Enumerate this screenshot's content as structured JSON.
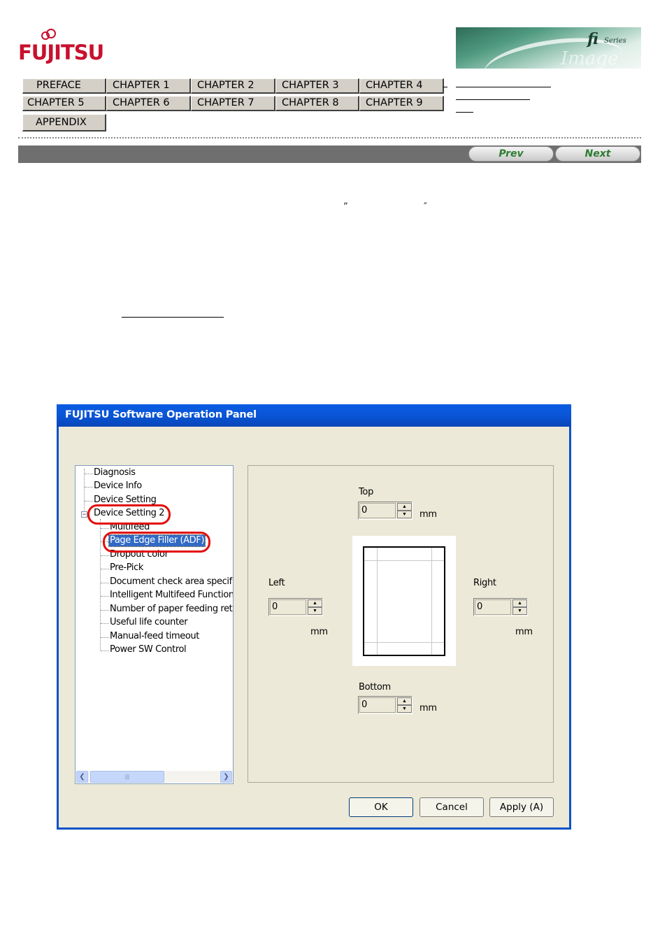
{
  "header": {
    "logo_text": "FUJITSU",
    "banner": {
      "fi": "fi",
      "series": "Series",
      "scanner": "Image Scanner"
    }
  },
  "nav": {
    "buttons": [
      "PREFACE",
      "CHAPTER 1",
      "CHAPTER 2",
      "CHAPTER 3",
      "CHAPTER 4",
      "CHAPTER 5",
      "CHAPTER 6",
      "CHAPTER 7",
      "CHAPTER 8",
      "CHAPTER 9",
      "APPENDIX"
    ],
    "prev_label": "Prev",
    "next_label": "Next"
  },
  "body": {
    "open_quote": "”",
    "close_quote": "″"
  },
  "dialog": {
    "title": "FUJITSU Software Operation Panel",
    "tree": {
      "items": [
        "Diagnosis",
        "Device Info",
        "Device Setting",
        "Device Setting 2"
      ],
      "expander": "−",
      "children": [
        "Multifeed",
        "Page Edge Filler (ADF)",
        "Dropout color",
        "Pre-Pick",
        "Document check area specific",
        "Intelligent Multifeed Function",
        "Number of paper feeding retrie",
        "Useful life counter",
        "Manual-feed timeout",
        "Power SW Control"
      ],
      "scroll_left": "❮",
      "scroll_right": "❯",
      "scroll_grip": "|||"
    },
    "panel": {
      "top": {
        "label": "Top",
        "value": "0",
        "unit": "mm"
      },
      "left": {
        "label": "Left",
        "value": "0",
        "unit": "mm"
      },
      "right": {
        "label": "Right",
        "value": "0",
        "unit": "mm"
      },
      "bottom": {
        "label": "Bottom",
        "value": "0",
        "unit": "mm"
      },
      "spin_up": "▲",
      "spin_down": "▼"
    },
    "buttons": {
      "ok": "OK",
      "cancel": "Cancel",
      "apply": "Apply (A)"
    },
    "highlight_color": "#e30d0d",
    "selection_color": "#316ac5"
  }
}
